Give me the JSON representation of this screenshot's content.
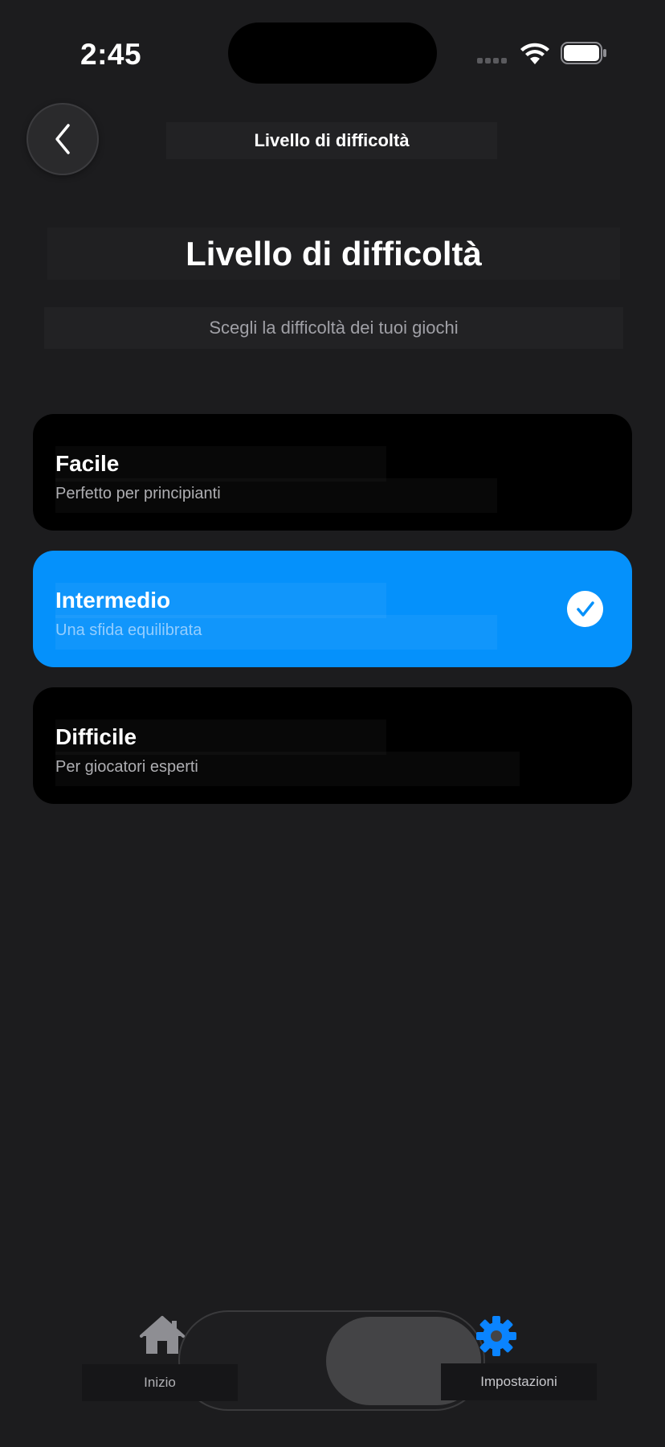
{
  "status_bar": {
    "time": "2:45"
  },
  "nav": {
    "title": "Livello di difficoltà"
  },
  "header": {
    "title": "Livello di difficoltà",
    "subtitle": "Scegli la difficoltà dei tuoi giochi"
  },
  "options": [
    {
      "title": "Facile",
      "subtitle": "Perfetto per principianti",
      "selected": false
    },
    {
      "title": "Intermedio",
      "subtitle": "Una sfida equilibrata",
      "selected": true
    },
    {
      "title": "Difficile",
      "subtitle": "Per giocatori esperti",
      "selected": false
    }
  ],
  "tab_bar": {
    "items": [
      {
        "label": "Inizio",
        "icon": "house-icon",
        "active": false
      },
      {
        "label": "Impostazioni",
        "icon": "gear-icon",
        "active": true
      }
    ]
  },
  "colors": {
    "background": "#1c1c1e",
    "accent": "#0591fb",
    "card": "#000000"
  }
}
